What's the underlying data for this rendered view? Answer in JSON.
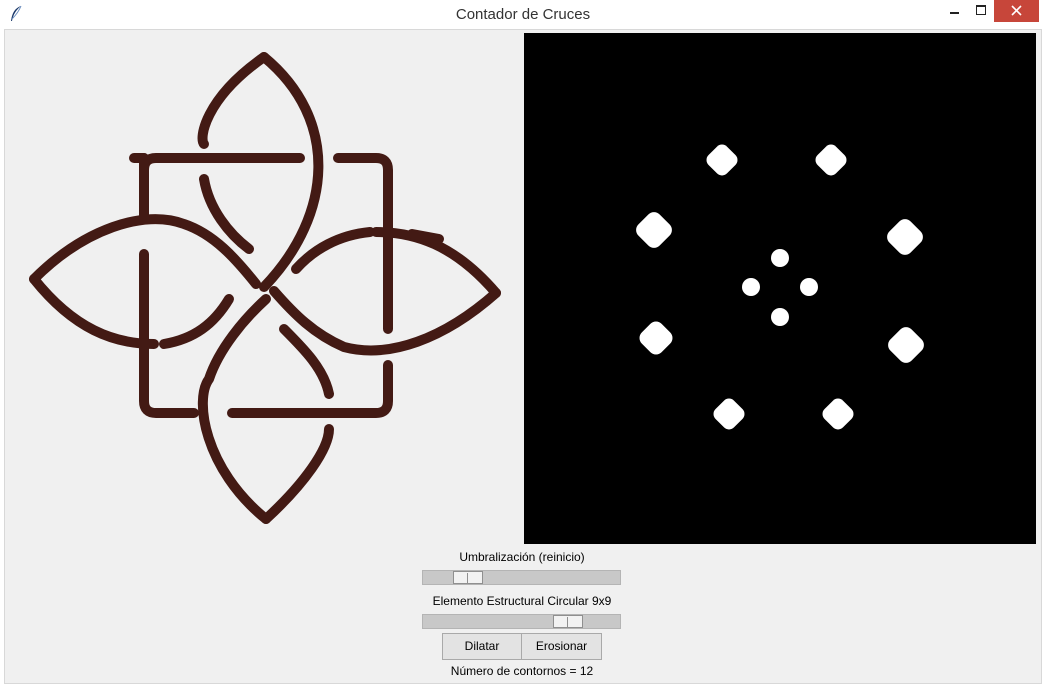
{
  "window": {
    "title": "Contador de Cruces"
  },
  "controls": {
    "threshold_label": "Umbralización (reinicio)",
    "threshold_level": 0.18,
    "structuring_label": "Elemento Estructural Circular 9x9",
    "structuring_level": 0.78,
    "dilate_label": "Dilatar",
    "erode_label": "Erosionar"
  },
  "status": {
    "contours_text": "Número de contornos = 12"
  },
  "colors": {
    "knot": "#431a14",
    "close_button": "#c7463a",
    "panel_bg": "#f0f0f0"
  }
}
